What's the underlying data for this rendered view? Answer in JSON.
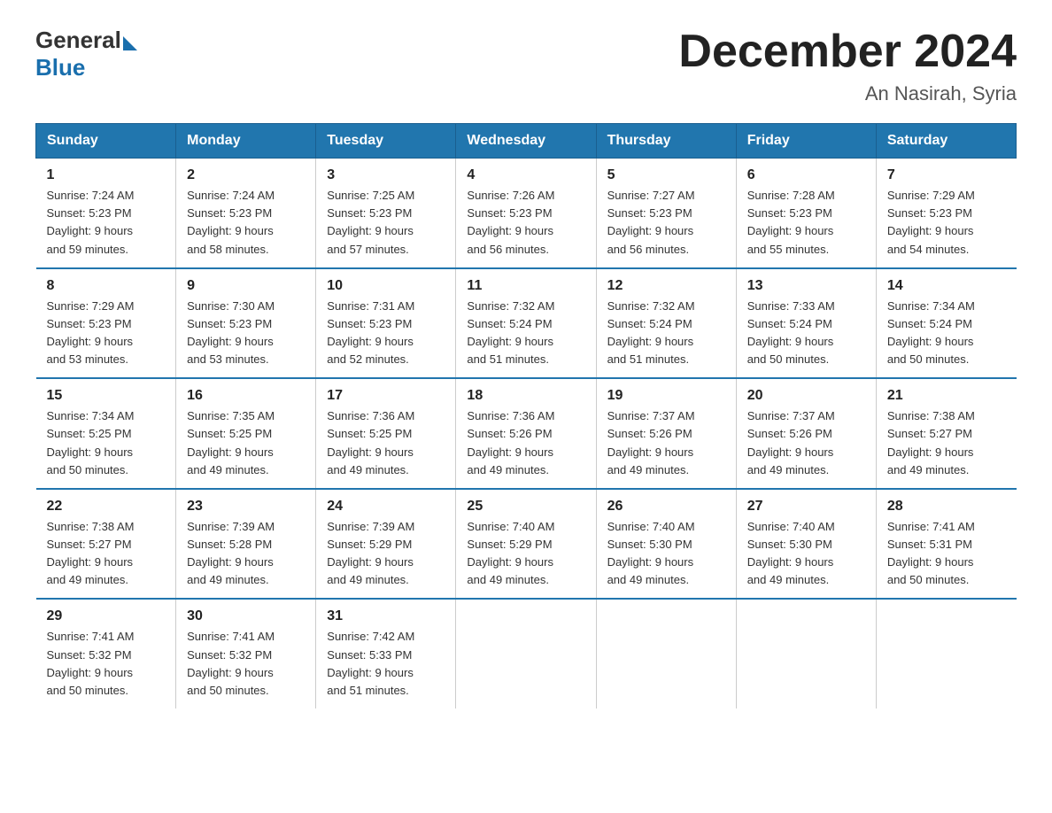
{
  "logo": {
    "general": "General",
    "blue": "Blue"
  },
  "title": "December 2024",
  "location": "An Nasirah, Syria",
  "days_of_week": [
    "Sunday",
    "Monday",
    "Tuesday",
    "Wednesday",
    "Thursday",
    "Friday",
    "Saturday"
  ],
  "weeks": [
    [
      {
        "day": "1",
        "sunrise": "7:24 AM",
        "sunset": "5:23 PM",
        "daylight": "9 hours and 59 minutes."
      },
      {
        "day": "2",
        "sunrise": "7:24 AM",
        "sunset": "5:23 PM",
        "daylight": "9 hours and 58 minutes."
      },
      {
        "day": "3",
        "sunrise": "7:25 AM",
        "sunset": "5:23 PM",
        "daylight": "9 hours and 57 minutes."
      },
      {
        "day": "4",
        "sunrise": "7:26 AM",
        "sunset": "5:23 PM",
        "daylight": "9 hours and 56 minutes."
      },
      {
        "day": "5",
        "sunrise": "7:27 AM",
        "sunset": "5:23 PM",
        "daylight": "9 hours and 56 minutes."
      },
      {
        "day": "6",
        "sunrise": "7:28 AM",
        "sunset": "5:23 PM",
        "daylight": "9 hours and 55 minutes."
      },
      {
        "day": "7",
        "sunrise": "7:29 AM",
        "sunset": "5:23 PM",
        "daylight": "9 hours and 54 minutes."
      }
    ],
    [
      {
        "day": "8",
        "sunrise": "7:29 AM",
        "sunset": "5:23 PM",
        "daylight": "9 hours and 53 minutes."
      },
      {
        "day": "9",
        "sunrise": "7:30 AM",
        "sunset": "5:23 PM",
        "daylight": "9 hours and 53 minutes."
      },
      {
        "day": "10",
        "sunrise": "7:31 AM",
        "sunset": "5:23 PM",
        "daylight": "9 hours and 52 minutes."
      },
      {
        "day": "11",
        "sunrise": "7:32 AM",
        "sunset": "5:24 PM",
        "daylight": "9 hours and 51 minutes."
      },
      {
        "day": "12",
        "sunrise": "7:32 AM",
        "sunset": "5:24 PM",
        "daylight": "9 hours and 51 minutes."
      },
      {
        "day": "13",
        "sunrise": "7:33 AM",
        "sunset": "5:24 PM",
        "daylight": "9 hours and 50 minutes."
      },
      {
        "day": "14",
        "sunrise": "7:34 AM",
        "sunset": "5:24 PM",
        "daylight": "9 hours and 50 minutes."
      }
    ],
    [
      {
        "day": "15",
        "sunrise": "7:34 AM",
        "sunset": "5:25 PM",
        "daylight": "9 hours and 50 minutes."
      },
      {
        "day": "16",
        "sunrise": "7:35 AM",
        "sunset": "5:25 PM",
        "daylight": "9 hours and 49 minutes."
      },
      {
        "day": "17",
        "sunrise": "7:36 AM",
        "sunset": "5:25 PM",
        "daylight": "9 hours and 49 minutes."
      },
      {
        "day": "18",
        "sunrise": "7:36 AM",
        "sunset": "5:26 PM",
        "daylight": "9 hours and 49 minutes."
      },
      {
        "day": "19",
        "sunrise": "7:37 AM",
        "sunset": "5:26 PM",
        "daylight": "9 hours and 49 minutes."
      },
      {
        "day": "20",
        "sunrise": "7:37 AM",
        "sunset": "5:26 PM",
        "daylight": "9 hours and 49 minutes."
      },
      {
        "day": "21",
        "sunrise": "7:38 AM",
        "sunset": "5:27 PM",
        "daylight": "9 hours and 49 minutes."
      }
    ],
    [
      {
        "day": "22",
        "sunrise": "7:38 AM",
        "sunset": "5:27 PM",
        "daylight": "9 hours and 49 minutes."
      },
      {
        "day": "23",
        "sunrise": "7:39 AM",
        "sunset": "5:28 PM",
        "daylight": "9 hours and 49 minutes."
      },
      {
        "day": "24",
        "sunrise": "7:39 AM",
        "sunset": "5:29 PM",
        "daylight": "9 hours and 49 minutes."
      },
      {
        "day": "25",
        "sunrise": "7:40 AM",
        "sunset": "5:29 PM",
        "daylight": "9 hours and 49 minutes."
      },
      {
        "day": "26",
        "sunrise": "7:40 AM",
        "sunset": "5:30 PM",
        "daylight": "9 hours and 49 minutes."
      },
      {
        "day": "27",
        "sunrise": "7:40 AM",
        "sunset": "5:30 PM",
        "daylight": "9 hours and 49 minutes."
      },
      {
        "day": "28",
        "sunrise": "7:41 AM",
        "sunset": "5:31 PM",
        "daylight": "9 hours and 50 minutes."
      }
    ],
    [
      {
        "day": "29",
        "sunrise": "7:41 AM",
        "sunset": "5:32 PM",
        "daylight": "9 hours and 50 minutes."
      },
      {
        "day": "30",
        "sunrise": "7:41 AM",
        "sunset": "5:32 PM",
        "daylight": "9 hours and 50 minutes."
      },
      {
        "day": "31",
        "sunrise": "7:42 AM",
        "sunset": "5:33 PM",
        "daylight": "9 hours and 51 minutes."
      },
      null,
      null,
      null,
      null
    ]
  ],
  "labels": {
    "sunrise": "Sunrise:",
    "sunset": "Sunset:",
    "daylight": "Daylight:"
  }
}
